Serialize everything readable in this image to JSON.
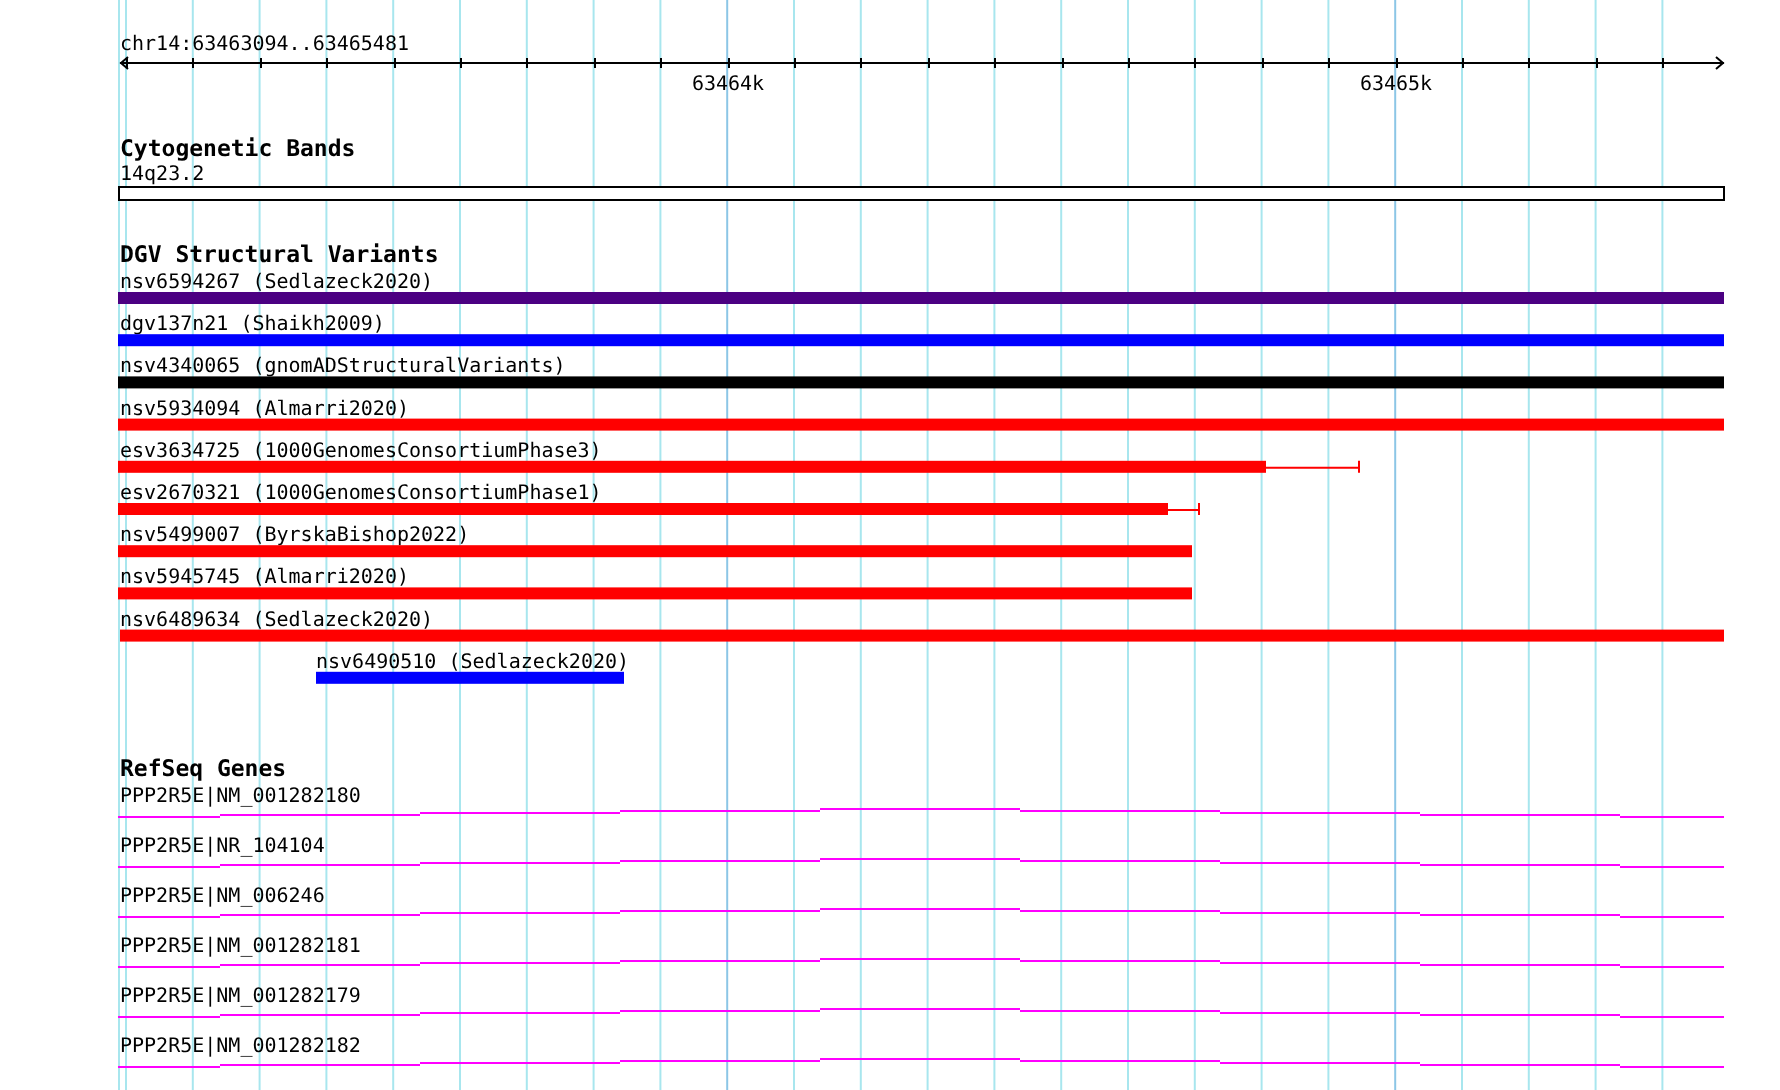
{
  "ruler": {
    "region": "chr14:63463094..63465481",
    "ticks": [
      {
        "label": "63464k"
      },
      {
        "label": "63465k"
      }
    ]
  },
  "tracks": [
    {
      "kind": "cytoband",
      "title": "Cytogenetic Bands",
      "features": [
        {
          "label": "14q23.2"
        }
      ]
    },
    {
      "kind": "variants",
      "title": "DGV Structural Variants",
      "features": [
        {
          "label": "nsv6594267 (Sedlazeck2020)",
          "color": "#4b0082"
        },
        {
          "label": "dgv137n21 (Shaikh2009)",
          "color": "#0000ff"
        },
        {
          "label": "nsv4340065 (gnomADStructuralVariants)",
          "color": "#000000"
        },
        {
          "label": "nsv5934094 (Almarri2020)",
          "color": "#ff0000"
        },
        {
          "label": "esv3634725 (1000GenomesConsortiumPhase3)",
          "color": "#ff0000"
        },
        {
          "label": "esv2670321 (1000GenomesConsortiumPhase1)",
          "color": "#ff0000"
        },
        {
          "label": "nsv5499007 (ByrskaBishop2022)",
          "color": "#ff0000"
        },
        {
          "label": "nsv5945745 (Almarri2020)",
          "color": "#ff0000"
        },
        {
          "label": "nsv6489634 (Sedlazeck2020)",
          "color": "#ff0000"
        },
        {
          "label": "nsv6490510 (Sedlazeck2020)",
          "color": "#0000ff"
        }
      ]
    },
    {
      "kind": "genes",
      "title": "RefSeq Genes",
      "features": [
        {
          "label": "PPP2R5E|NM_001282180"
        },
        {
          "label": "PPP2R5E|NR_104104"
        },
        {
          "label": "PPP2R5E|NM_006246"
        },
        {
          "label": "PPP2R5E|NM_001282181"
        },
        {
          "label": "PPP2R5E|NM_001282179"
        },
        {
          "label": "PPP2R5E|NM_001282182"
        }
      ]
    }
  ]
}
